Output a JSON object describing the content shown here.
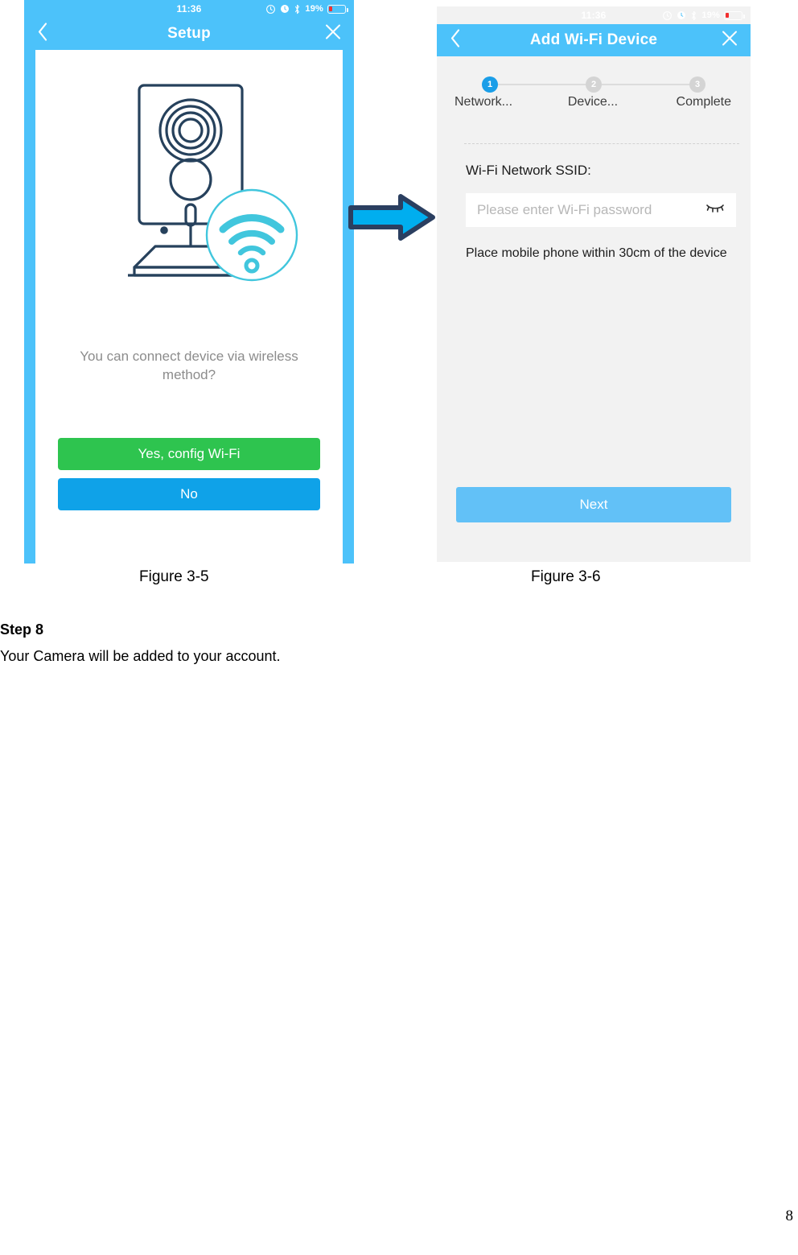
{
  "document": {
    "step_heading": "Step 8",
    "body_text": "Your Camera will be added to your account.",
    "page_number": "8",
    "figures": {
      "left_caption": "Figure 3-5",
      "right_caption": "Figure 3-6"
    },
    "flow_arrow": {
      "icon": "arrow-right-icon",
      "fill": "#00aeef",
      "stroke": "#2b3f60"
    }
  },
  "phone_left": {
    "status_bar": {
      "signal_dots": 5,
      "time": "11:36",
      "rotation_lock_icon": "rotation-lock-icon",
      "alarm_icon": "alarm-clock-icon",
      "bluetooth_icon": "bluetooth-icon",
      "battery_percent": "19%",
      "battery_level": 19,
      "battery_color": "#f22f2f"
    },
    "navbar": {
      "back_icon": "chevron-left-icon",
      "title": "Setup",
      "close_icon": "close-icon",
      "background": "#4cc2fa"
    },
    "illustration": {
      "name": "wifi-camera-illustration",
      "line_color": "#26415c",
      "accent_color": "#41c6dd"
    },
    "prompt": "You can connect device via wireless method?",
    "buttons": {
      "yes": {
        "label": "Yes, config Wi-Fi",
        "color": "#2ec44f"
      },
      "no": {
        "label": "No",
        "color": "#0fa2e8"
      }
    }
  },
  "phone_right": {
    "status_bar": {
      "signal_dots": 5,
      "time": "11:36",
      "rotation_lock_icon": "rotation-lock-icon",
      "alarm_icon": "alarm-clock-icon",
      "bluetooth_icon": "bluetooth-icon",
      "battery_percent": "19%",
      "battery_level": 19,
      "battery_color": "#f22f2f"
    },
    "navbar": {
      "back_icon": "chevron-left-icon",
      "title": "Add Wi-Fi Device",
      "close_icon": "close-icon",
      "background": "#4cc2fa"
    },
    "stepper": {
      "active_index": 1,
      "steps": [
        {
          "number": "1",
          "label": "Network...",
          "state": "active"
        },
        {
          "number": "2",
          "label": "Device...",
          "state": "idle"
        },
        {
          "number": "3",
          "label": "Complete",
          "state": "idle"
        }
      ],
      "active_color": "#1a9ee8",
      "idle_color": "#d4d4d4"
    },
    "form": {
      "ssid_label": "Wi-Fi Network SSID:",
      "password_value": "",
      "password_placeholder": "Please enter Wi-Fi password",
      "toggle_visibility_icon": "eye-closed-icon",
      "hint": "Place mobile phone within 30cm of the device"
    },
    "next_button": {
      "label": "Next",
      "color": "#62c1f7"
    }
  }
}
